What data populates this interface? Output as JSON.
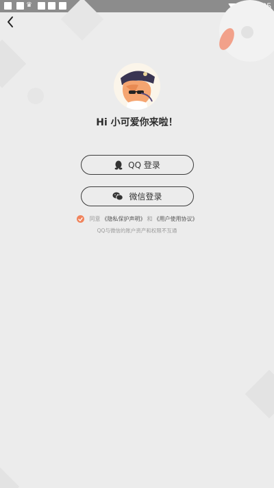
{
  "status_bar": {
    "time": "3:05",
    "left_icons": [
      "image-icon",
      "square-icon",
      "crown-icon",
      "square-icon",
      "square-icon",
      "square-icon"
    ],
    "right_icons": [
      "wifi-icon",
      "signal-icon",
      "battery-icon"
    ]
  },
  "nav": {
    "back_icon": "chevron-left-icon"
  },
  "greeting": "Hi 小可爱你来啦！",
  "buttons": {
    "qq_label": "QQ 登录",
    "qq_icon": "qq-penguin-icon",
    "wechat_label": "微信登录",
    "wechat_icon": "wechat-icon"
  },
  "agreement": {
    "checked": true,
    "prefix": "同意",
    "privacy_link": "《隐私保护声明》",
    "conjunction": "和",
    "user_agreement_link": "《用户使用协议》"
  },
  "notice": "QQ与微信的账户资产和权限不互通",
  "colors": {
    "background": "#ececec",
    "status_bar": "#8c8c8c",
    "accent": "#f0835c",
    "button_border": "#3a3a3a"
  }
}
